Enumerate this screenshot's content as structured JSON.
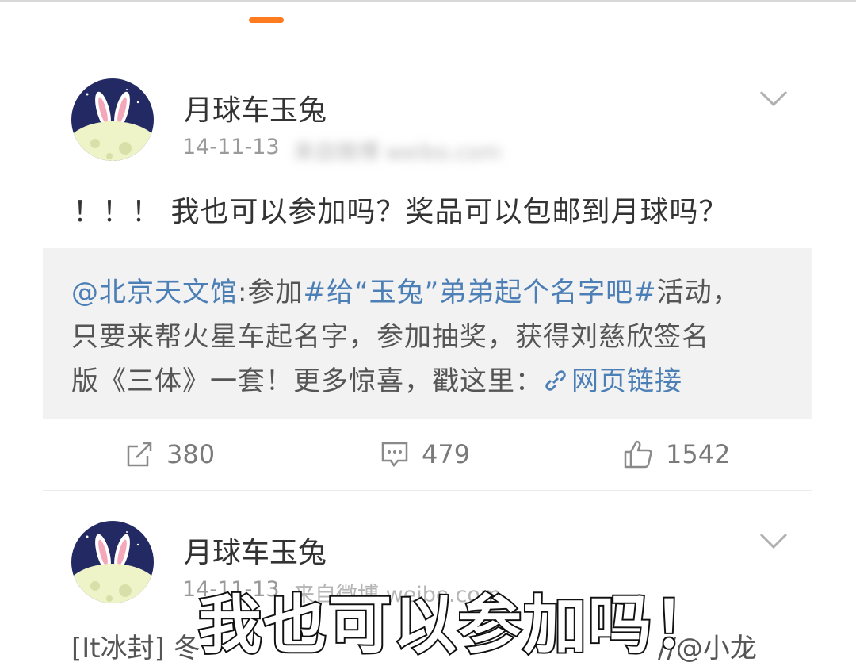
{
  "posts": [
    {
      "username": "月球车玉兔",
      "time": "14-11-13",
      "source": "来自微博 weibo.com",
      "text": "！！！ 我也可以参加吗？奖品可以包邮到月球吗？",
      "repost": {
        "mention": "@北京天文馆",
        "colon": ":参加",
        "hashtag": "#给“玉兔”弟弟起个名字吧#",
        "line1_tail": "活动，",
        "line2": "只要来帮火星车起名字，参加抽奖，获得刘慈欣签名",
        "line3": "版《三体》一套！更多惊喜，戳这里：",
        "link_label": "网页链接"
      },
      "actions": {
        "repost_count": "380",
        "comment_count": "479",
        "like_count": "1542"
      }
    },
    {
      "username": "月球车玉兔",
      "time_partial": "14-11-13",
      "source_partial": "来自微博 weibo.com",
      "text_partial_left": "[It冰封] 冬",
      "text_partial_right": "//@小龙"
    }
  ],
  "caption": "我也可以参加吗！",
  "colors": {
    "accent": "#ff7b20",
    "link": "#4c7fb6"
  }
}
